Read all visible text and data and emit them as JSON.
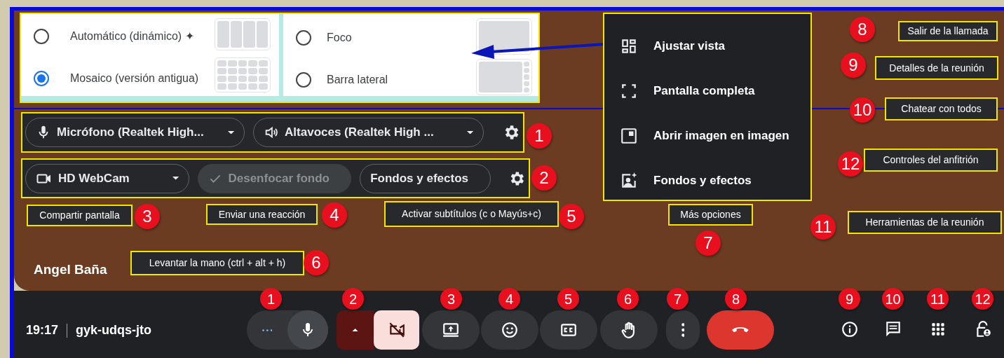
{
  "layout_dialog": {
    "options": [
      {
        "label": "Automático (dinámico) ✦",
        "selected": false
      },
      {
        "label": "Mosaico (versión antigua)",
        "selected": true
      },
      {
        "label": "Foco",
        "selected": false
      },
      {
        "label": "Barra lateral",
        "selected": false
      }
    ]
  },
  "more_options_menu": [
    {
      "label": "Ajustar vista"
    },
    {
      "label": "Pantalla completa"
    },
    {
      "label": "Abrir imagen en imagen"
    },
    {
      "label": "Fondos y efectos"
    }
  ],
  "audio_row": {
    "microphone": "Micrófono (Realtek High...",
    "speaker": "Altavoces (Realtek High ...",
    "callout": "1"
  },
  "video_row": {
    "camera": "HD WebCam",
    "blur": {
      "label": "Desenfocar fondo",
      "disabled": true
    },
    "effects": "Fondos y efectos",
    "callout": "2"
  },
  "tooltips": [
    {
      "callout": "8",
      "text": "Salir de la llamada"
    },
    {
      "callout": "9",
      "text": "Detalles de la reunión"
    },
    {
      "callout": "10",
      "text": "Chatear con todos"
    },
    {
      "callout": "12",
      "text": "Controles del anfitrión"
    },
    {
      "callout": "3",
      "text": "Compartir pantalla"
    },
    {
      "callout": "4",
      "text": "Enviar una reacción"
    },
    {
      "callout": "5",
      "text": "Activar subtítulos (c o Mayús+c)"
    },
    {
      "callout": "7",
      "text": "Más opciones"
    },
    {
      "callout": "11",
      "text": "Herramientas de la reunión"
    },
    {
      "callout": "6",
      "text": "Levantar la mano (ctrl + alt + h)"
    }
  ],
  "participant_name": "Angel Baña",
  "bottom_bar": {
    "time": "19:17",
    "meeting_code": "gyk-udqs-jto",
    "controls": [
      {
        "kind": "mic",
        "callout": "1"
      },
      {
        "kind": "camera",
        "callout": "2",
        "on": false
      },
      {
        "kind": "share",
        "callout": "3"
      },
      {
        "kind": "reaction",
        "callout": "4"
      },
      {
        "kind": "captions",
        "callout": "5"
      },
      {
        "kind": "hand",
        "callout": "6"
      },
      {
        "kind": "more",
        "callout": "7"
      },
      {
        "kind": "leave",
        "callout": "8"
      }
    ],
    "side_controls": [
      {
        "kind": "info",
        "callout": "9"
      },
      {
        "kind": "chat",
        "callout": "10"
      },
      {
        "kind": "apps",
        "callout": "11"
      },
      {
        "kind": "host",
        "callout": "12"
      }
    ]
  }
}
